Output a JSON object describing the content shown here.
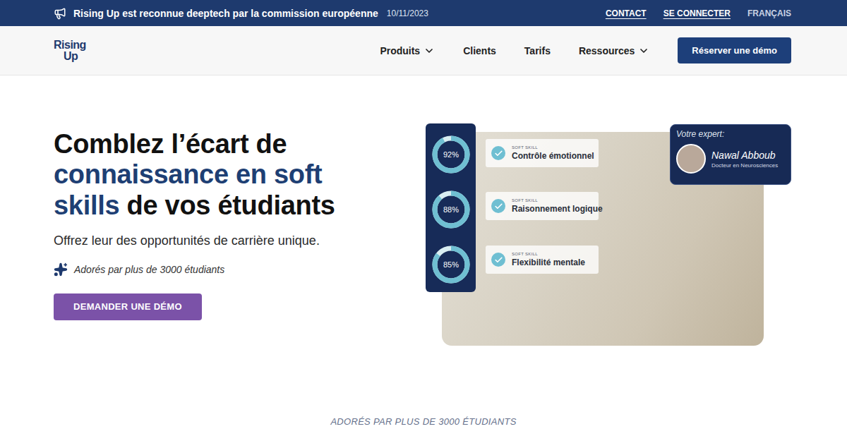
{
  "announcement": {
    "text": "Rising Up est reconnue deeptech par la commission européenne",
    "date": "10/11/2023"
  },
  "top_links": [
    {
      "label": "CONTACT",
      "underlined": true
    },
    {
      "label": "SE CONNECTER",
      "underlined": true
    },
    {
      "label": "FRANÇAIS",
      "underlined": false
    }
  ],
  "logo": {
    "line1": "Rising",
    "line2": "Up"
  },
  "nav": {
    "items": [
      {
        "label": "Produits",
        "dropdown": true
      },
      {
        "label": "Clients",
        "dropdown": false
      },
      {
        "label": "Tarifs",
        "dropdown": false
      },
      {
        "label": "Ressources",
        "dropdown": true
      }
    ],
    "cta": "Réserver une démo"
  },
  "hero": {
    "title": [
      {
        "text": "Comblez l’écart de ",
        "highlight": false
      },
      {
        "text": "connaissance en soft skills",
        "highlight": true
      },
      {
        "text": " de vos étudiants",
        "highlight": false
      }
    ],
    "subtitle": "Offrez leur des opportunités de carrière unique.",
    "rating": "Adorés par plus de 3000 étudiants",
    "button": "DEMANDER UNE DÉMO"
  },
  "visual": {
    "meters": [
      {
        "reading": "92%",
        "level": 0.92
      },
      {
        "reading": "88%",
        "level": 0.88
      },
      {
        "reading": "85%",
        "level": 0.85
      }
    ],
    "skills": [
      {
        "tag": "SOFT SKILL",
        "label": "Contrôle émotionnel",
        "checked": true
      },
      {
        "tag": "SOFT SKILL",
        "label": "Raisonnement logique",
        "checked": true
      },
      {
        "tag": "SOFT SKILL",
        "label": "Flexibilité mentale",
        "checked": true
      }
    ],
    "expert": {
      "heading": "Votre expert:",
      "name": "Nawal Abboub",
      "title": "Docteur en Neurosciences"
    }
  },
  "social_proof": "ADORÉS PAR PLUS DE 3000 ÉTUDIANTS"
}
